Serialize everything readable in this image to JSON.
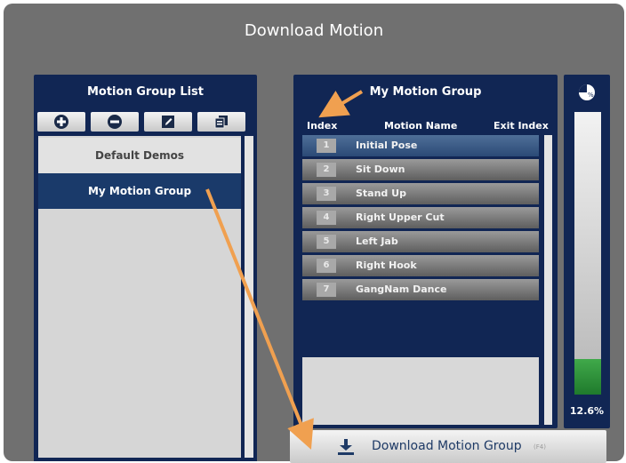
{
  "window": {
    "title": "Download Motion"
  },
  "motion_group_list": {
    "title": "Motion Group List",
    "toolbar": [
      {
        "name": "add",
        "icon": "plus-circle-icon"
      },
      {
        "name": "remove",
        "icon": "minus-circle-icon"
      },
      {
        "name": "edit",
        "icon": "pencil-edit-icon"
      },
      {
        "name": "copy",
        "icon": "copy-icon"
      }
    ],
    "items": [
      {
        "label": "Default Demos",
        "selected": false
      },
      {
        "label": "My Motion Group",
        "selected": true
      }
    ]
  },
  "motion_group": {
    "title": "My Motion Group",
    "columns": {
      "index": "Index",
      "motion_name": "Motion Name",
      "exit_index": "Exit Index"
    },
    "rows": [
      {
        "index": "1",
        "name": "Initial Pose",
        "selected": true
      },
      {
        "index": "2",
        "name": "Sit Down",
        "selected": false
      },
      {
        "index": "3",
        "name": "Stand Up",
        "selected": false
      },
      {
        "index": "4",
        "name": "Right Upper Cut",
        "selected": false
      },
      {
        "index": "5",
        "name": "Left Jab",
        "selected": false
      },
      {
        "index": "6",
        "name": "Right Hook",
        "selected": false
      },
      {
        "index": "7",
        "name": "GangNam Dance",
        "selected": false
      }
    ]
  },
  "progress": {
    "label": "12.6%",
    "fraction": 0.126,
    "icon": "percent-pie-icon"
  },
  "download_button": {
    "label": "Download Motion Group",
    "shortcut": "(F4)",
    "icon": "download-icon"
  },
  "colors": {
    "panel": "#112654",
    "selected": "#1a3a6a",
    "annotation_arrow": "#f0a050",
    "progress_fill": "#2e9a3c"
  }
}
